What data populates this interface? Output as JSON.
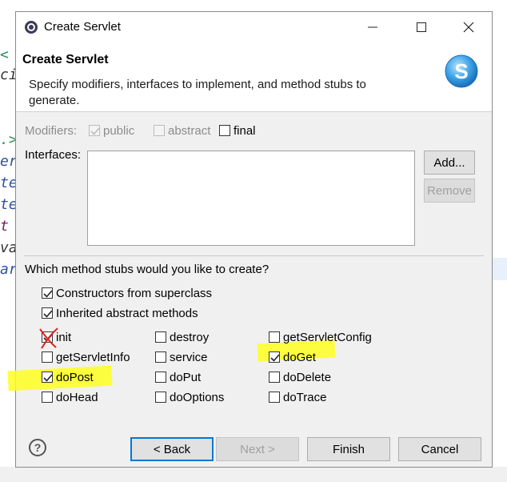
{
  "window": {
    "title": "Create Servlet"
  },
  "header": {
    "title": "Create Servlet",
    "description": "Specify modifiers, interfaces to implement, and method stubs to generate."
  },
  "modifiers": {
    "label": "Modifiers:",
    "public": {
      "label": "public",
      "checked": true,
      "enabled": false
    },
    "abstract": {
      "label": "abstract",
      "checked": false,
      "enabled": false
    },
    "final": {
      "label": "final",
      "checked": false,
      "enabled": true
    }
  },
  "interfaces": {
    "label": "Interfaces:",
    "add_label": "Add...",
    "remove_label": "Remove"
  },
  "stubs": {
    "question": "Which method stubs would you like to create?",
    "constructors": {
      "label": "Constructors from superclass",
      "checked": true
    },
    "inherited": {
      "label": "Inherited abstract methods",
      "checked": true
    },
    "methods": [
      {
        "label": "init",
        "checked": true,
        "annotation": "red-x"
      },
      {
        "label": "destroy",
        "checked": false
      },
      {
        "label": "getServletConfig",
        "checked": false
      },
      {
        "label": "getServletInfo",
        "checked": false
      },
      {
        "label": "service",
        "checked": false
      },
      {
        "label": "doGet",
        "checked": true,
        "highlight": "yellow"
      },
      {
        "label": "doPost",
        "checked": true,
        "highlight": "yellow"
      },
      {
        "label": "doPut",
        "checked": false
      },
      {
        "label": "doDelete",
        "checked": false
      },
      {
        "label": "doHead",
        "checked": false
      },
      {
        "label": "doOptions",
        "checked": false
      },
      {
        "label": "doTrace",
        "checked": false
      }
    ]
  },
  "footer": {
    "help_label": "?",
    "back_label": "< Back",
    "next_label": "Next >",
    "finish_label": "Finish",
    "cancel_label": "Cancel"
  },
  "background_code": [
    "<",
    "ci",
    ".>",
    "er",
    "te",
    "te",
    "t v",
    "va",
    "ar"
  ],
  "colors": {
    "highlight": "#ffff20",
    "accent": "#0078d7",
    "annotation": "#e02020"
  }
}
